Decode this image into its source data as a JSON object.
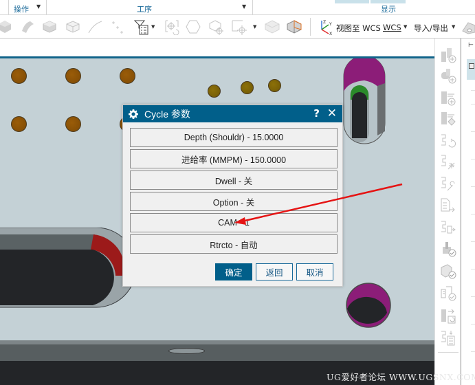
{
  "ribbon": {
    "groups": [
      {
        "label": "操作",
        "has_dropdown": true
      },
      {
        "label": "工序",
        "has_dropdown": true
      },
      {
        "label": "显示",
        "has_dropdown": false
      }
    ],
    "tools": [
      {
        "name": "solid-shaded-icon"
      },
      {
        "name": "surface-icon"
      },
      {
        "name": "block-shaded-icon"
      },
      {
        "name": "block-wire-icon"
      },
      {
        "name": "curve-icon"
      },
      {
        "name": "points-icon"
      },
      {
        "name": "filter-list-icon"
      },
      {
        "name": "reorient-icon"
      },
      {
        "name": "hexagon-icon"
      },
      {
        "name": "block-csys-icon"
      },
      {
        "name": "csys-icon"
      },
      {
        "name": "translucent-block-icon"
      },
      {
        "name": "block-orange-edge-icon"
      },
      {
        "name": "wcs-axes-icon"
      }
    ],
    "view_to_wcs_label": "视图至 WCS",
    "wcs_label": "WCS",
    "import_export_label": "导入/导出",
    "part-icon": "part-icon"
  },
  "dialog": {
    "title": "Cycle 参数",
    "help_label": "?",
    "close_label": "✕",
    "params": [
      {
        "label": "Depth (Shouldr) - 15.0000"
      },
      {
        "label": "进给率 (MMPM) - 150.0000"
      },
      {
        "label": "Dwell - 关"
      },
      {
        "label": "Option - 关"
      },
      {
        "label": "CAM - 1"
      },
      {
        "label": "Rtrcto - 自动"
      }
    ],
    "ok_label": "确定",
    "back_label": "返回",
    "cancel_label": "取消"
  },
  "side_panel": {
    "icons": [
      "create-program-icon",
      "create-tool-icon",
      "create-geometry-icon",
      "create-method-icon",
      "regenerate-path-icon",
      "verify-path-icon",
      "edit-path-icon",
      "postprocess-icon",
      "shop-docs-icon",
      "check-geometry-icon",
      "check-gouge-icon",
      "check-machine-icon",
      "transform-replay-icon",
      "operation-list-icon"
    ]
  },
  "watermark": "UG爱好者论坛 WWW.UGSNX.COM",
  "colors": {
    "accent": "#015f8a",
    "viewport_bg": "#c4d1d6",
    "hole_brown": "#8b5206",
    "hole_olive": "#7f6407",
    "magenta": "#8c1d78",
    "red_face": "#9c1a1a",
    "green_face": "#2a8a2a",
    "dark_floor": "#232528",
    "arrow": "#e51313"
  }
}
